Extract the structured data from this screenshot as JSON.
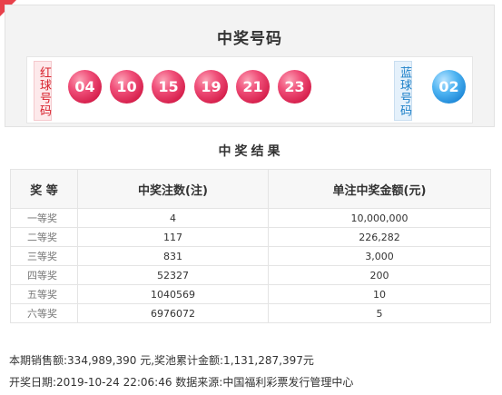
{
  "panel": {
    "title": "中奖号码",
    "red_label": "红球号码",
    "blue_label": "蓝球号码",
    "red_balls": [
      "04",
      "10",
      "15",
      "19",
      "21",
      "23"
    ],
    "blue_balls": [
      "02"
    ]
  },
  "results": {
    "title": "中奖结果",
    "headers": [
      "奖 等",
      "中奖注数(注)",
      "单注中奖金额(元)"
    ],
    "rows": [
      {
        "level": "一等奖",
        "count": "4",
        "amount": "10,000,000"
      },
      {
        "level": "二等奖",
        "count": "117",
        "amount": "226,282"
      },
      {
        "level": "三等奖",
        "count": "831",
        "amount": "3,000"
      },
      {
        "level": "四等奖",
        "count": "52327",
        "amount": "200"
      },
      {
        "level": "五等奖",
        "count": "1040569",
        "amount": "10"
      },
      {
        "level": "六等奖",
        "count": "6976072",
        "amount": "5"
      }
    ]
  },
  "footer": {
    "line1": "本期销售额:334,989,390 元,奖池累计金额:1,131,287,397元",
    "line2": "开奖日期:2019-10-24 22:06:46 数据来源:中国福利彩票发行管理中心"
  },
  "colors": {
    "accent_red": "#d8232e",
    "accent_blue": "#1d80c8"
  }
}
